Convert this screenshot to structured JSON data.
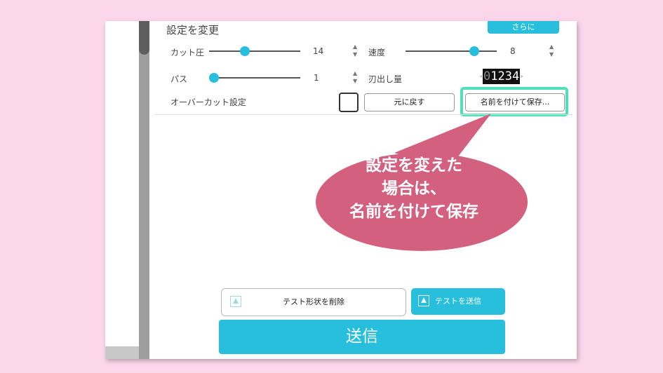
{
  "settings": {
    "title": "設定を変更",
    "more_button": "さらに",
    "cut_pressure": {
      "label": "カット圧",
      "value": "14",
      "level": 0.39
    },
    "speed": {
      "label": "速度",
      "value": "8",
      "level": 0.75
    },
    "passes": {
      "label": "パス",
      "value": "1",
      "level": 0.05
    },
    "blade_depth": {
      "label": "刃出し量",
      "digits": [
        "0",
        "1",
        "2",
        "3",
        "4"
      ]
    },
    "overcut": {
      "label": "オーバーカット設定",
      "checked": false
    },
    "revert_button": "元に戻す",
    "save_named_button": "名前を付けて保存..."
  },
  "actions": {
    "delete_test_label": "テスト形状を削除",
    "send_test_label": "テストを送信",
    "send_label": "送信"
  },
  "callout": {
    "lines": [
      "設定を変えた",
      "場合は、",
      "名前を付けて保存"
    ]
  },
  "colors": {
    "background": "#fcd6ea",
    "accent": "#27bfdc",
    "callout": "#d4607f",
    "highlight": "#4fe0b8"
  }
}
